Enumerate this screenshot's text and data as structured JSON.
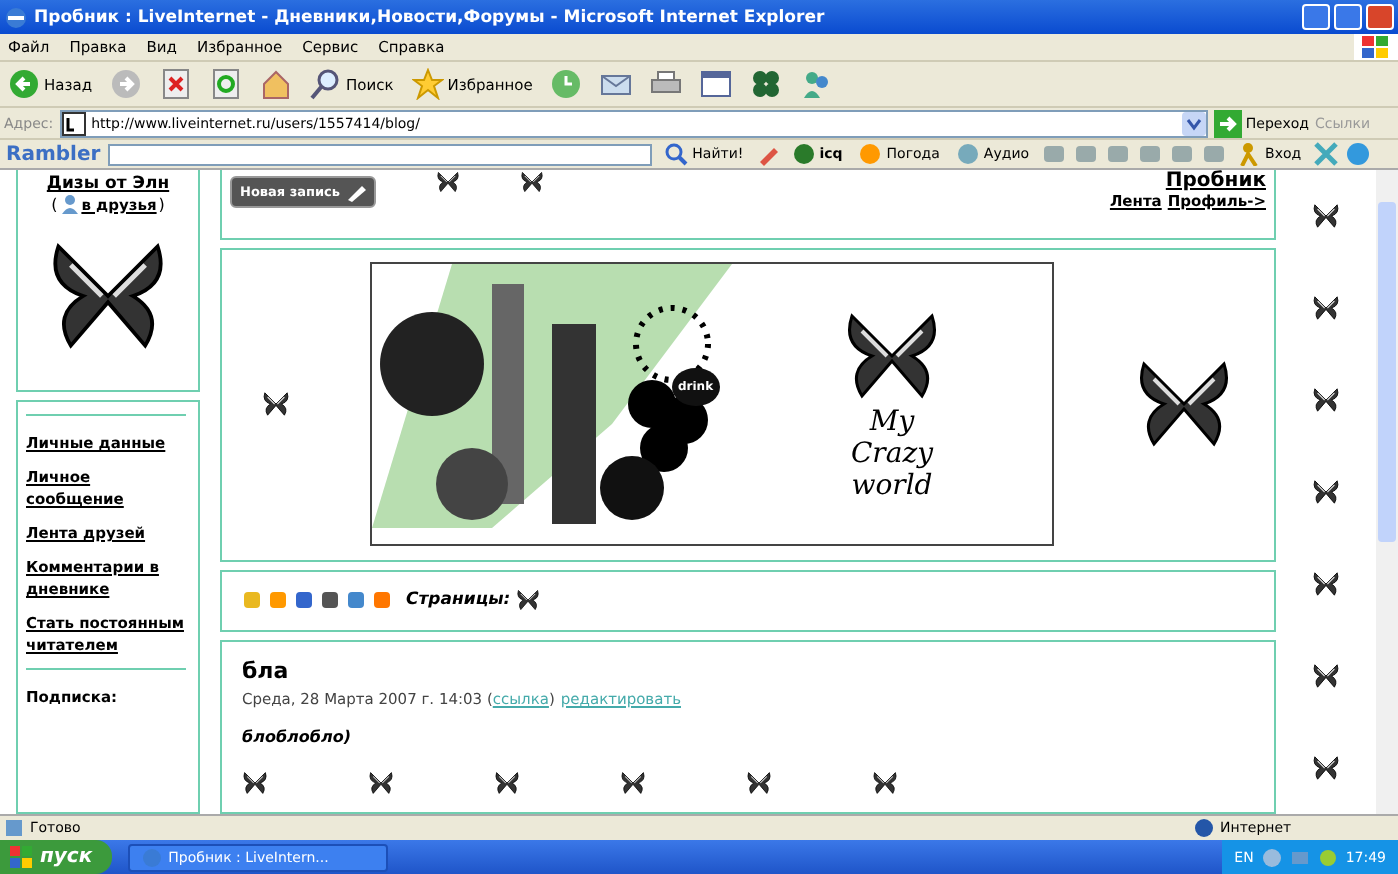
{
  "window": {
    "title": "Пробник : LiveInternet - Дневники,Новости,Форумы - Microsoft Internet Explorer"
  },
  "menu": [
    "Файл",
    "Правка",
    "Вид",
    "Избранное",
    "Сервис",
    "Справка"
  ],
  "toolbar": [
    {
      "kind": "back",
      "label": "Назад"
    },
    {
      "kind": "forward"
    },
    {
      "kind": "stop"
    },
    {
      "kind": "refresh"
    },
    {
      "kind": "home"
    },
    {
      "kind": "search",
      "label": "Поиск"
    },
    {
      "kind": "favorites",
      "label": "Избранное"
    },
    {
      "kind": "history"
    },
    {
      "kind": "mail"
    },
    {
      "kind": "print"
    },
    {
      "kind": "edit"
    },
    {
      "kind": "plugin"
    },
    {
      "kind": "messenger"
    }
  ],
  "address": {
    "label": "Адрес:",
    "url": "http://www.liveinternet.ru/users/1557414/blog/",
    "go": "Переход",
    "links": "Ссылки"
  },
  "rambler": {
    "logo": "Rambler",
    "search": "Найти!",
    "items": [
      {
        "kind": "icq",
        "label": "icq"
      },
      {
        "kind": "weather",
        "label": "Погода"
      },
      {
        "kind": "audio",
        "label": "Аудио"
      }
    ],
    "login": "Вход"
  },
  "sidebar": {
    "name": "Дизы от Элн",
    "friend": {
      "before": "(",
      "label": "в друзья",
      "after": ")"
    },
    "links": [
      "Личные данные",
      "Личное сообщение",
      "Лента друзей",
      "Комментарии в дневнике",
      "Стать постоянным читателем"
    ],
    "subscription": "Подписка:"
  },
  "header": {
    "new_post": "Новая запись",
    "user": "Пробник",
    "links": [
      "Лента",
      "Профиль->"
    ]
  },
  "banner": {
    "title": "My Crazy world",
    "sticker": "drink"
  },
  "pages": {
    "label": "Страницы:"
  },
  "post": {
    "title": "бла",
    "date": "Среда, 28 Марта 2007 г. 14:03 (",
    "link": "ссылка",
    "after": ")",
    "edit": "редактировать",
    "body": "блоблобло)"
  },
  "status_bar": {
    "text": "Готово",
    "zone": "Интернет"
  },
  "taskbar": {
    "start": "пуск",
    "task": "Пробник : LiveIntern...",
    "lang": "EN",
    "time": "17:49"
  }
}
